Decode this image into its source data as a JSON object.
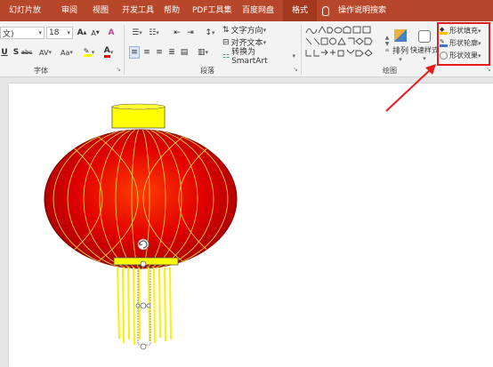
{
  "tabs": [
    {
      "label": "幻灯片放映"
    },
    {
      "label": "审阅"
    },
    {
      "label": "视图"
    },
    {
      "label": "开发工具"
    },
    {
      "label": "帮助"
    },
    {
      "label": "PDF工具集"
    },
    {
      "label": "百度网盘"
    },
    {
      "label": "格式"
    },
    {
      "label": "操作说明搜索"
    }
  ],
  "font": {
    "name_value": "文)",
    "size_value": "18",
    "group_label": "字体",
    "grow_label": "A",
    "shrink_label": "A",
    "underline_label": "U",
    "strike_label": "S",
    "spacing_label": "AV",
    "case_label": "Aa",
    "color_label": "A"
  },
  "paragraph": {
    "group_label": "段落",
    "text_direction_label": "文字方向",
    "align_text_label": "对齐文本",
    "smartart_label": "转换为 SmartArt"
  },
  "drawing": {
    "group_label": "绘图",
    "arrange_label": "排列",
    "quick_styles_label": "快速样式",
    "shape_fill_label": "形状填充",
    "shape_outline_label": "形状轮廓",
    "shape_effects_label": "形状效果"
  },
  "colors": {
    "accent": "#b7472a",
    "highlight": "#e81b1b",
    "lantern_red": "#d40000",
    "lantern_gold": "#ffff00"
  }
}
